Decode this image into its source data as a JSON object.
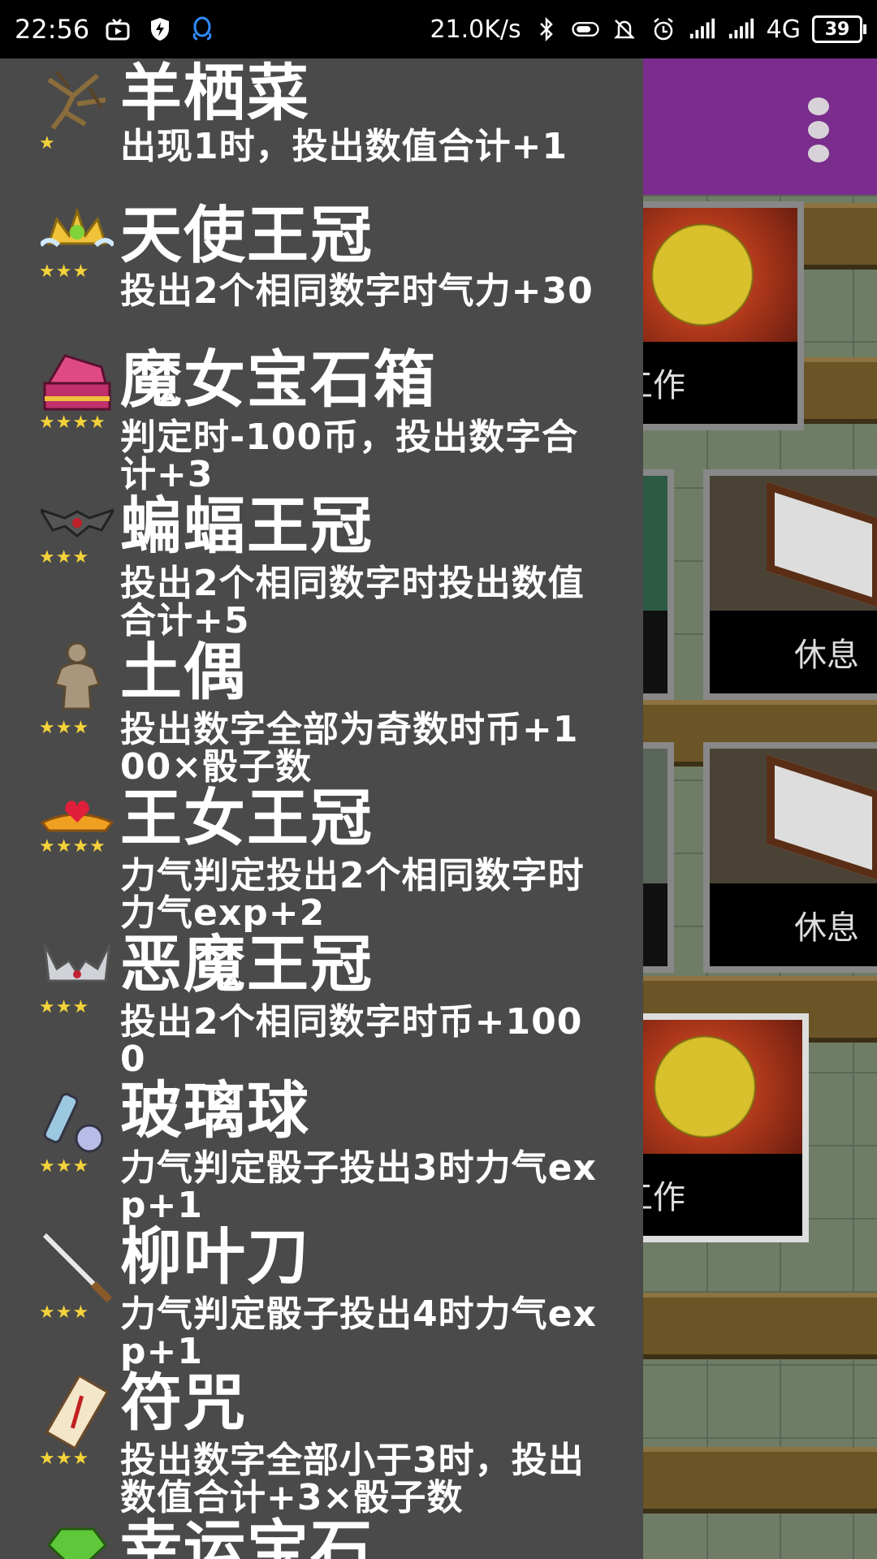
{
  "status_bar": {
    "time": "22:56",
    "net_speed": "21.0K/s",
    "network": "4G",
    "battery": "39",
    "icons": [
      "tv-icon",
      "shield-bolt-icon",
      "qq-icon",
      "bluetooth-icon",
      "toggle-icon",
      "bell-off-icon",
      "alarm-icon",
      "signal-icon",
      "signal-icon"
    ]
  },
  "scene": {
    "cards": [
      {
        "label": "工作",
        "art": "fire"
      },
      {
        "label": "休息",
        "art": "bed"
      },
      {
        "label": "休息",
        "art": "bed"
      },
      {
        "label": "工作",
        "art": "fire"
      }
    ]
  },
  "drawer": {
    "items": [
      {
        "name": "羊栖菜",
        "stars": "★",
        "desc": "出现1时，投出数值合计+1",
        "icon": "seaweed-icon"
      },
      {
        "name": "天使王冠",
        "stars": "★★★",
        "desc": "投出2个相同数字时气力+30",
        "icon": "angel-crown-icon"
      },
      {
        "name": "魔女宝石箱",
        "stars": "★★★★",
        "desc": "判定时-100币，投出数字合计+3",
        "icon": "jewel-box-icon"
      },
      {
        "name": "蝙蝠王冠",
        "stars": "★★★",
        "desc": "投出2个相同数字时投出数值合计+5",
        "icon": "bat-crown-icon"
      },
      {
        "name": "土偶",
        "stars": "★★★",
        "desc": "投出数字全部为奇数时币+100×骰子数",
        "icon": "clay-figure-icon"
      },
      {
        "name": "王女王冠",
        "stars": "★★★★",
        "desc": "力气判定投出2个相同数字时力气exp+2",
        "icon": "princess-crown-icon"
      },
      {
        "name": "恶魔王冠",
        "stars": "★★★",
        "desc": "投出2个相同数字时币+1000",
        "icon": "demon-crown-icon"
      },
      {
        "name": "玻璃球",
        "stars": "★★★",
        "desc": "力气判定骰子投出3时力气exp+1",
        "icon": "glass-ball-icon"
      },
      {
        "name": "柳叶刀",
        "stars": "★★★",
        "desc": "力气判定骰子投出4时力气exp+1",
        "icon": "lancet-icon"
      },
      {
        "name": "符咒",
        "stars": "★★★",
        "desc": "投出数字全部小于3时，投出数值合计+3×骰子数",
        "icon": "talisman-icon"
      },
      {
        "name": "幸运宝石",
        "stars": "",
        "desc": "",
        "icon": "lucky-gem-icon"
      }
    ]
  }
}
